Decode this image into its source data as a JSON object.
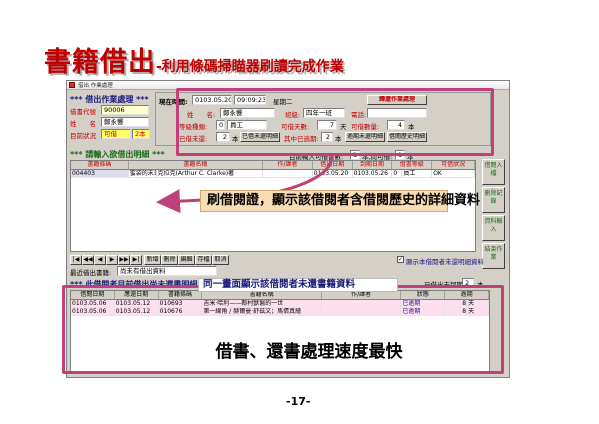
{
  "slide": {
    "title_main": "書籍借出",
    "title_sub": "-利用條碼掃瞄器刷讀完成作業",
    "page_number": "-17-"
  },
  "window": {
    "title": "借出 作業處理",
    "section_header": "*** 借出作業處理 ***",
    "borrower_code_label": "借書代號",
    "borrower_code_value": "90006",
    "name_label": "姓　　名",
    "name_value": "鄭永響",
    "status_label": "目前狀況",
    "status_value": "可借",
    "status_count": "2本"
  },
  "info_panel": {
    "current_time_label": "現在時間:",
    "date_value": "0103.05.20",
    "time_value": "09:09:23",
    "weekday": "星期二",
    "return_button": "歸還作業處理",
    "name_label": "姓　　名:",
    "name_value": "鄭永響",
    "class_label": "班級:",
    "class_value": "四年一班",
    "phone_label": "電話:",
    "level_label": "等級種類:",
    "level_code": "0",
    "level_value": "員工",
    "days_label": "可借天數:",
    "days_value": "7",
    "days_unit": "天",
    "quantity_label": "可借數量:",
    "quantity_value": "4",
    "quantity_unit": "本",
    "borrowed_label": "已借未還:",
    "borrowed_value": "2",
    "borrowed_unit": "本",
    "borrowed_button": "已借未還明細",
    "overdue_label": "其中已逾期:",
    "overdue_value": "2",
    "overdue_unit": "本",
    "overdue_button": "逾期未還明細",
    "history_button": "借閱歷史明細"
  },
  "input_section": {
    "header": "*** 請輸入欲借出明細 ***",
    "counter_label": "目前輸入可借書數:",
    "counter_value": "1",
    "counter_total": "本,尚可借:",
    "counter_remaining": "1",
    "counter_unit": "本",
    "columns": [
      "書籍條碼",
      "書籍名稱",
      "作/譯者",
      "借出日期",
      "到期日期",
      "借書等級",
      "可借狀況"
    ],
    "rows": [
      [
        "004403",
        "蜜袋的末日",
        "克拉克(Arthur C. Clarke)著",
        "0103.05.20",
        "0103.05.26",
        "0",
        "員工",
        "OK"
      ]
    ]
  },
  "toolbar": {
    "nav_buttons": [
      "|◀",
      "◀◀",
      "◀",
      "▶",
      "▶▶",
      "▶|"
    ],
    "actions": [
      "新增",
      "刪除",
      "編輯",
      "存檔",
      "取消"
    ],
    "checkbox_label": "顯示本借閱者未還明細資料",
    "last_borrow_label": "最近借出書籍:",
    "last_borrow_value": "尚未有借出資料",
    "days_notice_label": "已借出未超期:",
    "days_notice_value": "2",
    "days_notice_unit": "本"
  },
  "side_buttons": [
    "借閱入檔",
    "刪除記錄",
    "資料輸入",
    "結束作業"
  ],
  "unreturned_section": {
    "header": "*** 此借閱者目前借出尚未還書明細 ***",
    "columns": [
      "借閱日期",
      "應還日期",
      "書籍條碼",
      "書籍名稱",
      "作/譯者",
      "狀態",
      "逾期"
    ],
    "rows": [
      [
        "0103.05.06",
        "0103.05.12",
        "010693",
        "吉米·哈利——鄰村獸醫的一世",
        "",
        "已逾期",
        "8",
        "天"
      ],
      [
        "0103.05.06",
        "0103.05.12",
        "010676",
        "第一線角 / 赫爾曼·舒茲文；馬倩真繪",
        "",
        "已逾期",
        "8",
        "天"
      ]
    ]
  },
  "annotations": {
    "callout_history": "刷借閱證，顯示該借閱者含借閱歷史的詳細資料",
    "callout_unreturned": "同一畫面顯示該借閱者未還書籍資料",
    "callout_speed": "借書、還書處理速度最快"
  },
  "colors": {
    "title_red": "#c00000",
    "annotation_border": "#c0407a",
    "callout_bg": "#f7dcb4",
    "pink_row": "#fde0f0"
  }
}
